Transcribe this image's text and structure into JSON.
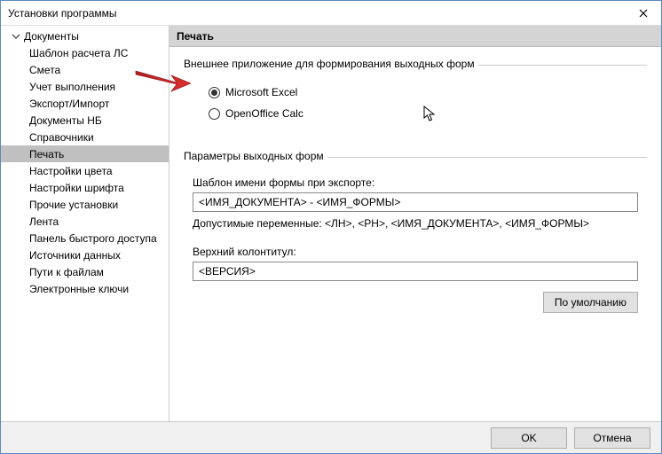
{
  "window": {
    "title": "Установки программы"
  },
  "sidebar": {
    "root": "Документы",
    "items": [
      {
        "label": "Шаблон расчета ЛС"
      },
      {
        "label": "Смета"
      },
      {
        "label": "Учет выполнения"
      },
      {
        "label": "Экспорт/Импорт"
      },
      {
        "label": "Документы НБ"
      },
      {
        "label": "Справочники"
      },
      {
        "label": "Печать",
        "selected": true
      },
      {
        "label": "Настройки цвета"
      },
      {
        "label": "Настройки шрифта"
      },
      {
        "label": "Прочие установки"
      },
      {
        "label": "Лента"
      },
      {
        "label": "Панель быстрого доступа"
      },
      {
        "label": "Источники данных"
      },
      {
        "label": "Пути к файлам"
      },
      {
        "label": "Электронные ключи"
      }
    ]
  },
  "content": {
    "header": "Печать",
    "group1": {
      "label": "Внешнее приложение для формирования выходных форм",
      "option1": "Microsoft Excel",
      "option2": "OpenOffice Calc",
      "selected": "option1"
    },
    "group2": {
      "label": "Параметры выходных форм",
      "template_label": "Шаблон имени формы при экспорте:",
      "template_value": "<ИМЯ_ДОКУМЕНТА> - <ИМЯ_ФОРМЫ>",
      "vars_hint": "Допустимые переменные: <ЛН>, <PH>, <ИМЯ_ДОКУМЕНТА>, <ИМЯ_ФОРМЫ>",
      "header_label": "Верхний колонтитул:",
      "header_value": "<ВЕРСИЯ>",
      "default_button": "По умолчанию"
    }
  },
  "footer": {
    "ok": "OK",
    "cancel": "Отмена"
  }
}
